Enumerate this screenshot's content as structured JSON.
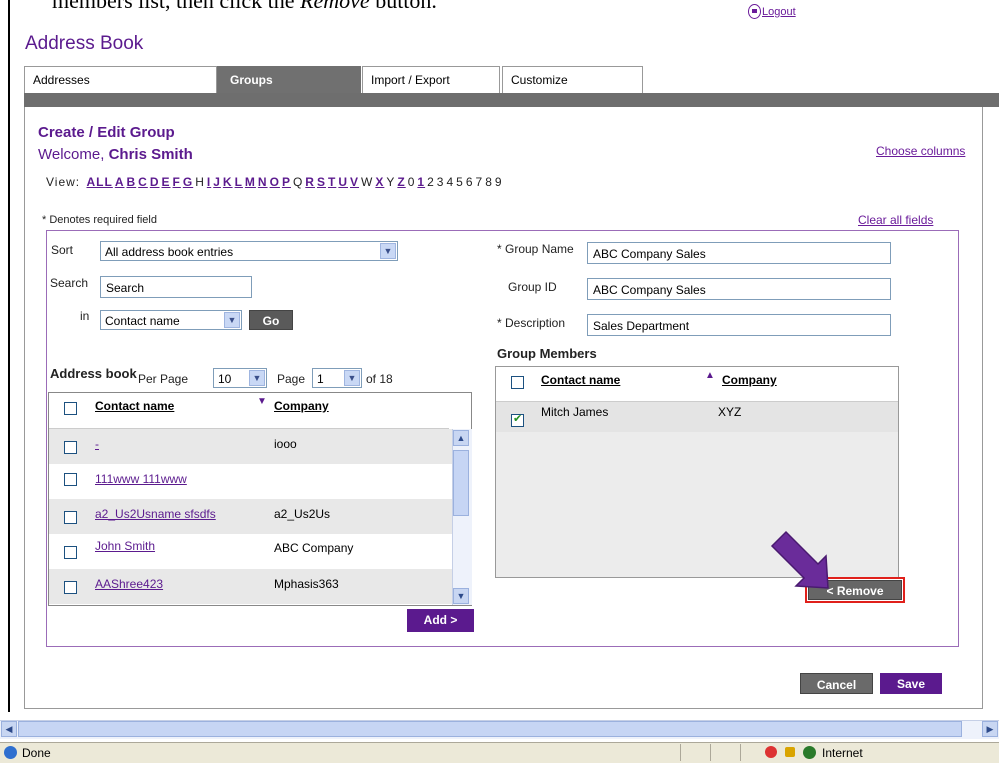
{
  "instruction": {
    "before": "members list, then click the ",
    "emph": "Remove",
    "after": " button."
  },
  "logout": "Logout",
  "title": "Address Book",
  "tabs": [
    {
      "label": "Addresses"
    },
    {
      "label": "Groups"
    },
    {
      "label": "Import / Export"
    },
    {
      "label": "Customize"
    }
  ],
  "heading": "Create / Edit Group",
  "welcome": {
    "prefix": "Welcome, ",
    "name": "Chris Smith"
  },
  "choose_columns": "Choose columns",
  "view": {
    "label": "View:",
    "items": [
      {
        "t": "ALL",
        "link": true
      },
      {
        "t": "A",
        "link": true
      },
      {
        "t": "B",
        "link": true
      },
      {
        "t": "C",
        "link": true
      },
      {
        "t": "D",
        "link": true
      },
      {
        "t": "E",
        "link": true
      },
      {
        "t": "F",
        "link": true
      },
      {
        "t": "G",
        "link": true
      },
      {
        "t": "H",
        "link": false
      },
      {
        "t": "I",
        "link": true
      },
      {
        "t": "J",
        "link": true
      },
      {
        "t": "K",
        "link": true
      },
      {
        "t": "L",
        "link": true
      },
      {
        "t": "M",
        "link": true
      },
      {
        "t": "N",
        "link": true
      },
      {
        "t": "O",
        "link": true
      },
      {
        "t": "P",
        "link": true
      },
      {
        "t": "Q",
        "link": false
      },
      {
        "t": "R",
        "link": true
      },
      {
        "t": "S",
        "link": true
      },
      {
        "t": "T",
        "link": true
      },
      {
        "t": "U",
        "link": true
      },
      {
        "t": "V",
        "link": true
      },
      {
        "t": "W",
        "link": false
      },
      {
        "t": "X",
        "link": true
      },
      {
        "t": "Y",
        "link": false
      },
      {
        "t": "Z",
        "link": true
      },
      {
        "t": "0",
        "link": false
      },
      {
        "t": "1",
        "link": true
      },
      {
        "t": "2",
        "link": false
      },
      {
        "t": "3",
        "link": false
      },
      {
        "t": "4",
        "link": false
      },
      {
        "t": "5",
        "link": false
      },
      {
        "t": "6",
        "link": false
      },
      {
        "t": "7",
        "link": false
      },
      {
        "t": "8",
        "link": false
      },
      {
        "t": "9",
        "link": false
      }
    ]
  },
  "required_note": "* Denotes required field",
  "clear_all": "Clear all fields",
  "sort": {
    "label": "Sort",
    "value": "All address book entries"
  },
  "search": {
    "label": "Search",
    "value": "Search",
    "in_label": "in",
    "in_value": "Contact name",
    "go": "Go"
  },
  "address_book": {
    "title": "Address book",
    "per_page_label": "Per Page",
    "per_page": "10",
    "page_label": "Page",
    "page": "1",
    "of": "of 18",
    "col_contact": "Contact name",
    "col_company": "Company",
    "rows": [
      {
        "contact": "-",
        "company": "iooo"
      },
      {
        "contact": "111www 111www",
        "company": ""
      },
      {
        "contact": "a2_Us2Usname sfsdfs",
        "company": "a2_Us2Us"
      },
      {
        "contact": "John Smith",
        "company": "ABC Company"
      },
      {
        "contact": "AAShree423",
        "company": "Mphasis363"
      }
    ],
    "add": "Add >"
  },
  "group_name": {
    "label": "* Group Name",
    "value": "ABC Company Sales"
  },
  "group_id": {
    "label": "Group ID",
    "value": "ABC Company Sales"
  },
  "description": {
    "label": "* Description",
    "value": "Sales Department"
  },
  "members": {
    "title": "Group Members",
    "col_contact": "Contact name",
    "col_company": "Company",
    "rows": [
      {
        "contact": "Mitch James",
        "company": "XYZ",
        "checked": true
      }
    ],
    "remove": "< Remove"
  },
  "cancel": "Cancel",
  "save": "Save",
  "status": {
    "done": "Done",
    "zone": "Internet"
  },
  "colors": {
    "brand_purple": "#5b1a8e",
    "arrow": "#6a2c9a",
    "highlight": "#e0201b"
  }
}
